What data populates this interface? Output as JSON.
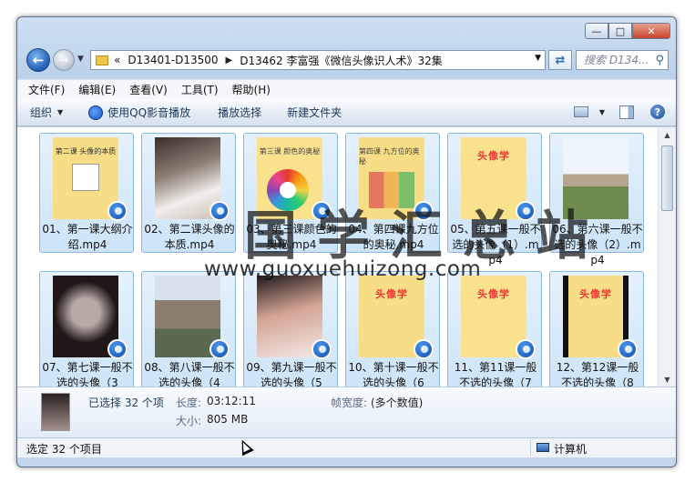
{
  "window": {
    "caption_buttons": [
      "minimize-icon",
      "maximize-icon",
      "close-icon"
    ],
    "accent": "#1f5fb4"
  },
  "address": {
    "prefix": "«",
    "crumbs": [
      "D13401-D13500",
      "D13462 李富强《微信头像识人术》32集"
    ],
    "search_placeholder": "搜索 D134..."
  },
  "menu": {
    "items": [
      "文件(F)",
      "编辑(E)",
      "查看(V)",
      "工具(T)",
      "帮助(H)"
    ]
  },
  "toolbar": {
    "organize": "组织",
    "play_qq": "使用QQ影音播放",
    "play_selection": "播放选择",
    "new_folder": "新建文件夹"
  },
  "files": [
    {
      "label": "01、第一课大纲介绍.mp4",
      "thumb_text": "第二课 头像的本质"
    },
    {
      "label": "02、第二课头像的本质.mp4",
      "thumb_text": ""
    },
    {
      "label": "03、第三课颜色的奥秘.mp4",
      "thumb_text": "第三课 颜色的奥秘"
    },
    {
      "label": "04、第四课九方位的奥秘.mp4",
      "thumb_text": "第四课 九方位的奥秘"
    },
    {
      "label": "05、第五课一般不选的头像（1）.mp4",
      "thumb_text": "头像学"
    },
    {
      "label": "06、第六课一般不选的头像（2）.mp4",
      "thumb_text": ""
    },
    {
      "label": "07、第七课一般不选的头像（3",
      "thumb_text": ""
    },
    {
      "label": "08、第八课一般不选的头像（4",
      "thumb_text": ""
    },
    {
      "label": "09、第九课一般不选的头像（5",
      "thumb_text": ""
    },
    {
      "label": "10、第十课一般不选的头像（6",
      "thumb_text": "头像学"
    },
    {
      "label": "11、第11课一般不选的头像（7",
      "thumb_text": "头像学"
    },
    {
      "label": "12、第12课一般不选的头像（8",
      "thumb_text": "头像学"
    }
  ],
  "details": {
    "selected": "已选择 32 个项",
    "duration_label": "长度:",
    "duration_value": "03:12:11",
    "size_label": "大小:",
    "size_value": "805 MB",
    "frame_width_label": "帧宽度:",
    "frame_width_value": "(多个数值)"
  },
  "status": {
    "left": "选定 32 个项目",
    "right": "计算机"
  },
  "watermark": {
    "title": "国学汇总站",
    "url": "www.guoxuehuizong.com"
  }
}
